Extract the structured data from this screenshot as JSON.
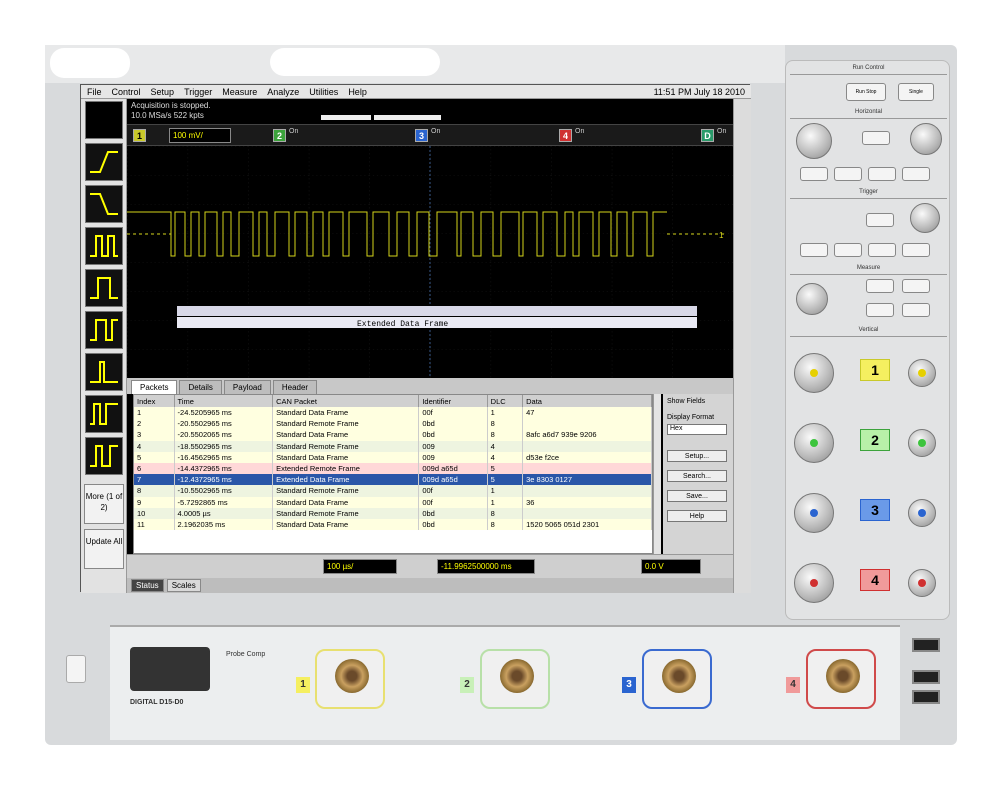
{
  "menu": {
    "items": [
      "File",
      "Control",
      "Setup",
      "Trigger",
      "Measure",
      "Analyze",
      "Utilities",
      "Help"
    ],
    "datetime": "11:51 PM July 18 2010"
  },
  "acquisition": {
    "line1": "Acquisition is stopped.",
    "line2": "10.0 MSa/s   522 kpts"
  },
  "channels": {
    "ch1": {
      "num": "1",
      "label": "",
      "value": "100 mV/",
      "color": "#c9c92a"
    },
    "ch2": {
      "num": "2",
      "label": "On",
      "color": "#3ca33c"
    },
    "ch3": {
      "num": "3",
      "label": "On",
      "color": "#2a64d0"
    },
    "ch4": {
      "num": "4",
      "label": "On",
      "color": "#d03030"
    },
    "digital": {
      "num": "D",
      "label": "On",
      "color": "#2a9a6a"
    }
  },
  "decode": {
    "banner": "Extended Data Frame"
  },
  "tabs": [
    "Packets",
    "Details",
    "Payload",
    "Header"
  ],
  "table": {
    "columns": [
      "Index",
      "Time",
      "CAN Packet",
      "Identifier",
      "DLC",
      "Data"
    ],
    "rows": [
      {
        "type": "std",
        "cells": [
          "1",
          "-24.5205965 ms",
          "Standard Data Frame",
          "00f",
          "1",
          "47"
        ]
      },
      {
        "type": "std",
        "cells": [
          "2",
          "-20.5502965 ms",
          "Standard Remote Frame",
          "0bd",
          "8",
          ""
        ]
      },
      {
        "type": "std",
        "cells": [
          "3",
          "-20.5502065 ms",
          "Standard Data Frame",
          "0bd",
          "8",
          "8afc a6d7 939e 9206"
        ]
      },
      {
        "type": "rem",
        "cells": [
          "4",
          "-18.5502965 ms",
          "Standard Remote Frame",
          "009",
          "4",
          ""
        ]
      },
      {
        "type": "std",
        "cells": [
          "5",
          "-16.4562965 ms",
          "Standard Data Frame",
          "009",
          "4",
          "d53e f2ce"
        ]
      },
      {
        "type": "ext",
        "cells": [
          "6",
          "-14.4372965 ms",
          "Extended Remote Frame",
          "009d a65d",
          "5",
          ""
        ]
      },
      {
        "type": "sel",
        "cells": [
          "7",
          "-12.4372965 ms",
          "Extended Data Frame",
          "009d a65d",
          "5",
          "3e 8303 0127"
        ]
      },
      {
        "type": "rem",
        "cells": [
          "8",
          "-10.5502965 ms",
          "Standard Remote Frame",
          "00f",
          "1",
          ""
        ]
      },
      {
        "type": "std",
        "cells": [
          "9",
          "-5.7292865 ms",
          "Standard Data Frame",
          "00f",
          "1",
          "36"
        ]
      },
      {
        "type": "rem",
        "cells": [
          "10",
          "4.0005 µs",
          "Standard Remote Frame",
          "0bd",
          "8",
          ""
        ]
      },
      {
        "type": "std",
        "cells": [
          "11",
          "2.1962035 ms",
          "Standard Data Frame",
          "0bd",
          "8",
          "1520 5065 051d 2301"
        ]
      }
    ]
  },
  "right_pane": {
    "show_fields": "Show Fields",
    "display_format": "Display Format",
    "format_value": "Hex",
    "buttons": [
      "Setup...",
      "Search...",
      "Save...",
      "Help"
    ]
  },
  "bottom": {
    "timebase": "100 µs/",
    "position": "-11.9962500000 ms",
    "trigger": "0.0 V"
  },
  "status_tabs": [
    "Status",
    "Scales"
  ],
  "left_buttons": {
    "more": "More (1 of 2)",
    "update": "Update All"
  },
  "front": {
    "model": "DIGITAL D15-D0",
    "probe_comp": "Probe Comp",
    "ports": [
      "1",
      "2",
      "3",
      "4"
    ]
  },
  "panel": {
    "run_control": "Run Control",
    "run_stop": "Run Stop",
    "single": "Single",
    "horizontal": "Horizontal",
    "trigger": "Trigger",
    "measure": "Measure",
    "vertical": "Vertical"
  }
}
